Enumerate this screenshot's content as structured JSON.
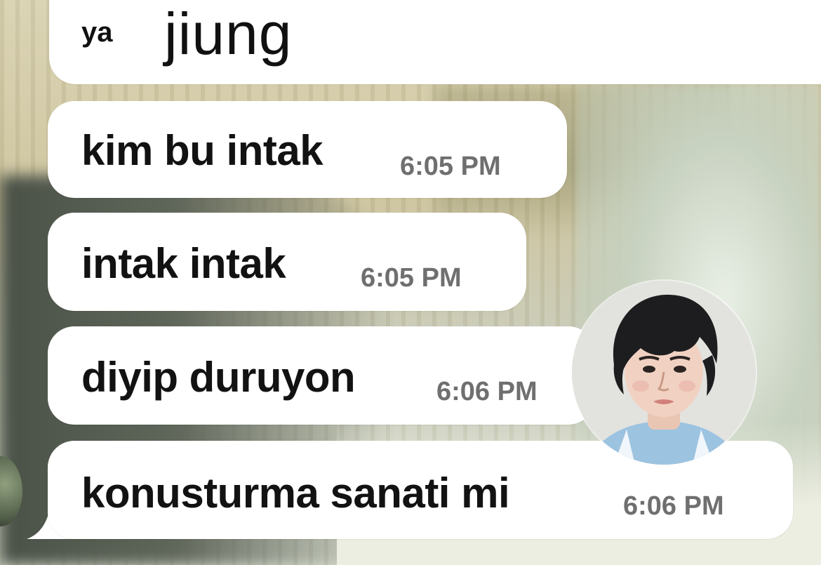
{
  "chat": {
    "messages": [
      {
        "prefix": "ya",
        "text": "jiung"
      },
      {
        "text": "kim bu intak",
        "time": "6:05 PM"
      },
      {
        "text": "intak intak",
        "time": "6:05 PM"
      },
      {
        "text": "diyip duruyon",
        "time": "6:06 PM"
      },
      {
        "text": "konusturma sanati mi",
        "time": "6:06 PM"
      }
    ],
    "avatar": {
      "icon": "profile-photo",
      "description_icon": "person-avatar-icon"
    }
  },
  "colors": {
    "bubble": "#ffffff",
    "message_text": "#121212",
    "timestamp": "#6f6f6f"
  }
}
